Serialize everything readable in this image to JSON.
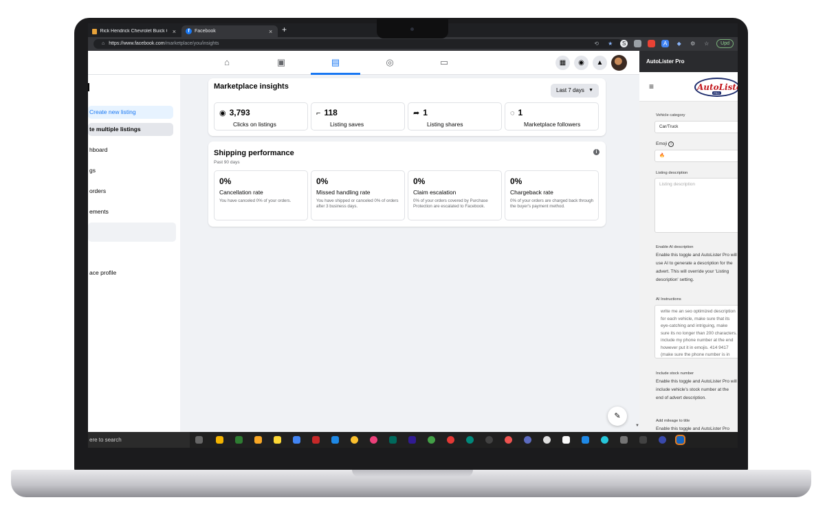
{
  "browser": {
    "tabs": [
      {
        "label": "Rick Hendrick Chevrolet Buick Gi",
        "active": false
      },
      {
        "label": "Facebook",
        "active": true
      }
    ],
    "new_tab": "+",
    "url_host": "https://www.facebook.com",
    "url_path": "/marketplace/you/insights",
    "update_label": "Upd"
  },
  "header": {
    "nav": [
      "home-icon",
      "video-icon",
      "marketplace-icon",
      "groups-icon",
      "gaming-icon"
    ],
    "active_nav": "marketplace-icon"
  },
  "sidebar": {
    "items": [
      {
        "label": "Create new listing"
      },
      {
        "label": "te multiple listings"
      },
      {
        "label": "hboard"
      },
      {
        "label": "gs"
      },
      {
        "label": "orders"
      },
      {
        "label": "ements"
      },
      {
        "label": "ace profile"
      }
    ]
  },
  "insights": {
    "title": "Marketplace insights",
    "range": "Last 7 days",
    "stats": [
      {
        "icon": "eye-icon",
        "value": "3,793",
        "label": "Clicks on listings"
      },
      {
        "icon": "bookmark-icon",
        "value": "118",
        "label": "Listing saves"
      },
      {
        "icon": "share-icon",
        "value": "1",
        "label": "Listing shares"
      },
      {
        "icon": "follower-icon",
        "value": "1",
        "label": "Marketplace followers"
      }
    ]
  },
  "shipping": {
    "title": "Shipping performance",
    "subtitle": "Past 90 days",
    "metrics": [
      {
        "value": "0%",
        "label": "Cancellation rate",
        "desc": "You have canceled 0% of your orders."
      },
      {
        "value": "0%",
        "label": "Missed handling rate",
        "desc": "You have shipped or canceled 0% of orders after 3 business days."
      },
      {
        "value": "0%",
        "label": "Claim escalation",
        "desc": "0% of your orders covered by Purchase Protection are escalated to Facebook."
      },
      {
        "value": "0%",
        "label": "Chargeback rate",
        "desc": "0% of your orders are charged back through the buyer's payment method."
      }
    ]
  },
  "extension": {
    "title": "AutoLister Pro",
    "logo_text": "AutoLister",
    "logo_sub": "PRO",
    "vehicle_category_label": "Vehicle category",
    "vehicle_category_value": "Car/Truck",
    "emoji_label": "Emoji",
    "emoji_info": "i",
    "emoji_value": "🔥",
    "listing_description_label": "Listing description",
    "listing_description_placeholder": "Listing description",
    "enable_ai_label": "Enable AI description",
    "enable_ai_text": "Enable this toggle and AutoLister Pro will use AI to generate a description for the advert. This will override your 'Listing description' setting.",
    "ai_instructions_label": "AI Instructions",
    "ai_instructions_text": "write me an seo optimized description for each vehicle, make sure that its eye-catching and intriguing, make sure its no longer than 200 characters. include my phone number at the end however put it in emojis. 414 9417 (make sure the phone number is in emoji numbers) my name is dylan.",
    "stock_label": "Include stock number",
    "stock_text": "Enable this toggle and AutoLister Pro will include vehicle's stock number at the end of advert description.",
    "mileage_label": "Add mileage to title",
    "mileage_text": "Enable this toggle and AutoLister Pro"
  },
  "taskbar": {
    "search_text": "ere to search"
  },
  "colors": {
    "facebook_blue": "#1877f2",
    "page_bg": "#f0f2f5",
    "autolister_red": "#c2161c",
    "autolister_navy": "#1b2a6b"
  }
}
